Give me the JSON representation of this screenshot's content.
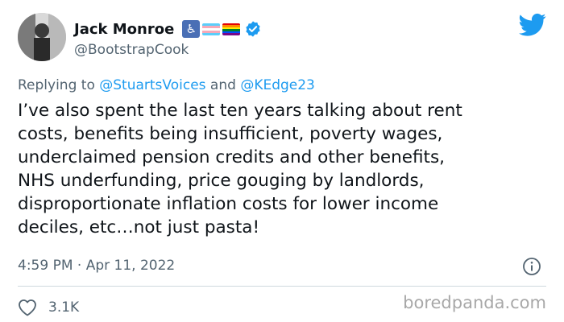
{
  "author": {
    "display_name": "Jack Monroe",
    "handle": "@BootstrapCook",
    "avatar_icon": "profile-photo",
    "badges": [
      "wheelchair-icon",
      "trans-flag-icon",
      "rainbow-flag-icon",
      "verified-badge-icon"
    ]
  },
  "platform_icon": "twitter-bird-icon",
  "reply": {
    "prefix": "Replying to ",
    "mention_1": "@StuartsVoices",
    "joiner": " and ",
    "mention_2": "@KEdge23"
  },
  "tweet": {
    "lines": [
      "I’ve also spent the last ten years talking about rent",
      "costs, benefits being insufficient, poverty wages,",
      "underclaimed pension credits and other benefits,",
      "NHS underfunding, price gouging by landlords,",
      "disproportionate inflation costs for lower income",
      "deciles, etc…not just pasta!"
    ]
  },
  "meta": {
    "timestamp": "4:59 PM · Apr 11, 2022",
    "like_count": "3.1K"
  },
  "watermark": "boredpanda.com",
  "colors": {
    "accent": "#1d9bf0",
    "muted_text": "#536471",
    "divider": "#cfd9de"
  }
}
